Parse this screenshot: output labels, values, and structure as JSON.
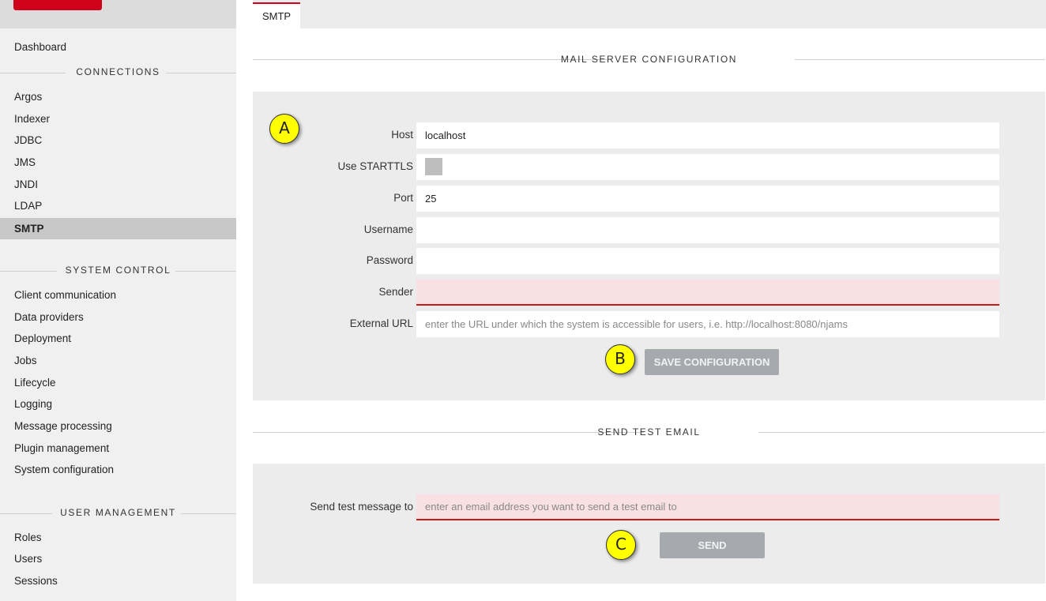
{
  "sidebar": {
    "dashboard": "Dashboard",
    "connections_header": "CONNECTIONS",
    "connections": [
      "Argos",
      "Indexer",
      "JDBC",
      "JMS",
      "JNDI",
      "LDAP",
      "SMTP"
    ],
    "system_control_header": "SYSTEM CONTROL",
    "system_control": [
      "Client communication",
      "Data providers",
      "Deployment",
      "Jobs",
      "Lifecycle",
      "Logging",
      "Message processing",
      "Plugin management",
      "System configuration"
    ],
    "user_management_header": "USER MANAGEMENT",
    "user_management": [
      "Roles",
      "Users",
      "Sessions"
    ]
  },
  "tab": {
    "label": "SMTP"
  },
  "mail_config": {
    "title": "MAIL SERVER CONFIGURATION",
    "host_label": "Host",
    "host_value": "localhost",
    "starttls_label": "Use STARTTLS",
    "port_label": "Port",
    "port_value": "25",
    "username_label": "Username",
    "password_label": "Password",
    "sender_label": "Sender",
    "external_url_label": "External URL",
    "external_url_placeholder": "enter the URL under which the system is accessible for users, i.e. http://localhost:8080/njams",
    "save_label": "SAVE CONFIGURATION"
  },
  "test_email": {
    "title": "SEND TEST EMAIL",
    "send_to_label": "Send test message to",
    "send_to_placeholder": "enter an email address you want to send a test email to",
    "send_label": "SEND"
  },
  "markers": {
    "a": "A",
    "b": "B",
    "c": "C"
  },
  "colors": {
    "accent": "#d0021b",
    "active_nav": "#c8c8c8",
    "invalid_bg": "#f9e1e3",
    "marker": "#ffff00"
  }
}
